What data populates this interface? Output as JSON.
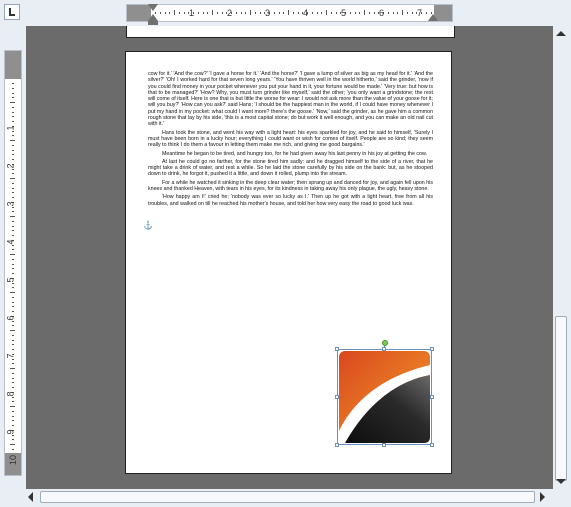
{
  "ruler": {
    "horizontal_numbers": [
      "1",
      "2",
      "3",
      "4",
      "5",
      "6",
      "7"
    ],
    "vertical_numbers": [
      "1",
      "2",
      "3",
      "4",
      "5",
      "6",
      "7",
      "8",
      "9",
      "10"
    ]
  },
  "document": {
    "paragraphs": [
      "cow for it.' 'And the cow?' 'I gave a horse for it.' 'And the horse?' 'I gave a lump of silver as big as my head for it.' 'And the silver?' 'Oh! I worked hard for that seven long years.' 'You have thriven well in the world hitherto,' said the grinder, 'now if you could find money in your pocket whenever you put your hand in it, your fortune would be made.' 'Very true: but how is that to be managed?' 'How? Why, you must turn grinder like myself,' said the other; 'you only want a grindstone; the rest will come of itself. Here is one that is but little the worse for wear: I would not ask more than the value of your goose for it; will you buy?' 'How can you ask?' said Hans; 'I should be the happiest man in the world, if I could have money whenever I put my hand in my pocket: what could I want more? there's the goose.' 'Now,' said the grinder, as he gave him a common rough stone that lay by his side, 'this is a most capital stone; do but work it well enough, and you can make an old nail cut with it.'",
      "Hans took the stone, and went his way with a light heart: his eyes sparkled for joy, and he said to himself, 'Surely I must have been born in a lucky hour; everything I could want or wish for comes of itself. People are so kind; they seem really to think I do them a favour in letting them make me rich, and giving me good bargains.'",
      "Meantime he began to be tired, and hungry too, for he had given away his last penny in his joy at getting the cow.",
      "At last he could go no farther, for the stone tired him sadly: and he dragged himself to the side of a river, that he might take a drink of water, and rest a while. So he laid the stone carefully by his side on the bank: but, as he stooped down to drink, he forgot it, pushed it a little, and down it rolled, plump into the stream.",
      "For a while he watched it sinking in the deep clear water; then sprang up and danced for joy, and again fell upon his knees and thanked Heaven, with tears in his eyes, for its kindness in taking away his only plague, the ugly, heavy stone.",
      "'How happy am I!' cried he; 'nobody was ever so lucky as I.' Then up he got with a light heart, free from all his troubles, and walked on till he reached his mother's house, and told her how very easy the road to good luck was."
    ],
    "anchor_glyph": "⚓"
  },
  "image": {
    "icon": "abstract-orange-black-image",
    "colors": {
      "orange_light": "#f08a24",
      "orange_dark": "#d9481e",
      "black": "#111111",
      "grey": "#6a6a6a"
    }
  },
  "colors": {
    "workspace": "#6b6b6b",
    "ruler_margin": "#8f8f8f",
    "chrome": "#e9eef5"
  }
}
